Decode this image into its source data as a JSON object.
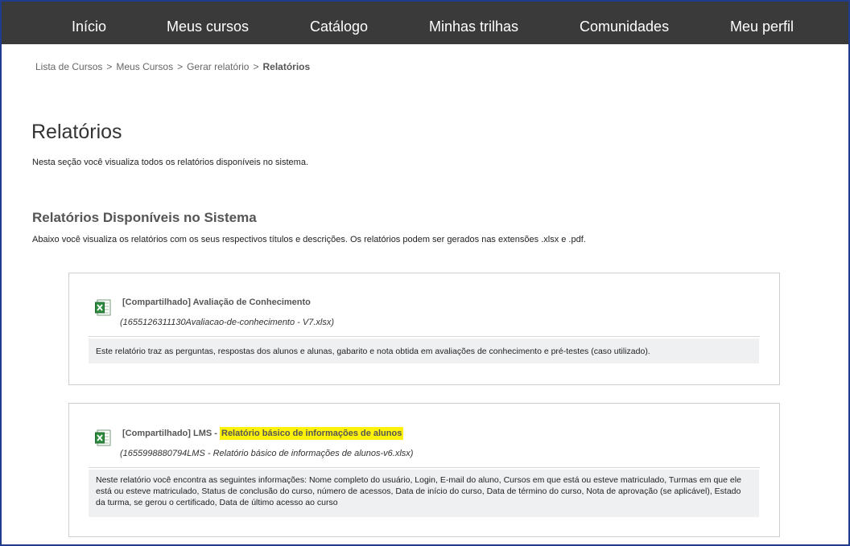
{
  "nav": {
    "items": [
      {
        "label": "Início"
      },
      {
        "label": "Meus cursos"
      },
      {
        "label": "Catálogo"
      },
      {
        "label": "Minhas trilhas"
      },
      {
        "label": "Comunidades"
      },
      {
        "label": "Meu perfil"
      }
    ]
  },
  "breadcrumb": {
    "items": [
      "Lista de Cursos",
      "Meus Cursos",
      "Gerar relatório"
    ],
    "current": "Relatórios",
    "separator": ">"
  },
  "page": {
    "title": "Relatórios",
    "description": "Nesta seção você visualiza todos os relatórios disponíveis no sistema."
  },
  "section": {
    "title": "Relatórios Disponíveis no Sistema",
    "description": "Abaixo você visualiza os relatórios com os seus respectivos títulos e descrições. Os relatórios podem ser gerados nas extensões .xlsx e .pdf."
  },
  "reports": [
    {
      "icon": "excel-icon",
      "title": "[Compartilhado] Avaliação de Conhecimento",
      "file": "(1655126311130Avaliacao-de-conhecimento - V7.xlsx)",
      "description": "Este relatório traz as perguntas, respostas dos alunos e alunas, gabarito e nota obtida em avaliações de conhecimento e pré-testes (caso utilizado)."
    },
    {
      "icon": "excel-icon",
      "title_prefix": "[Compartilhado] LMS - ",
      "title_highlight": "Relatório básico de informações de alunos",
      "file": "(1655998880794LMS - Relatório básico de informações de alunos-v6.xlsx)",
      "description": "Neste relatório você encontra as seguintes informações: Nome completo do usuário, Login, E-mail do aluno, Cursos em que está ou esteve matriculado, Turmas em que ele está ou esteve matriculado, Status de conclusão do curso, número de acessos, Data de início do curso, Data de término do curso, Nota de aprovação (se aplicável), Estado da turma, se gerou o certificado, Data de último acesso ao curso"
    }
  ],
  "colors": {
    "nav_bg": "#3a3a3a",
    "highlight": "#fff20a",
    "desc_bg": "#eef0f2",
    "frame": "#1f3d8a"
  }
}
